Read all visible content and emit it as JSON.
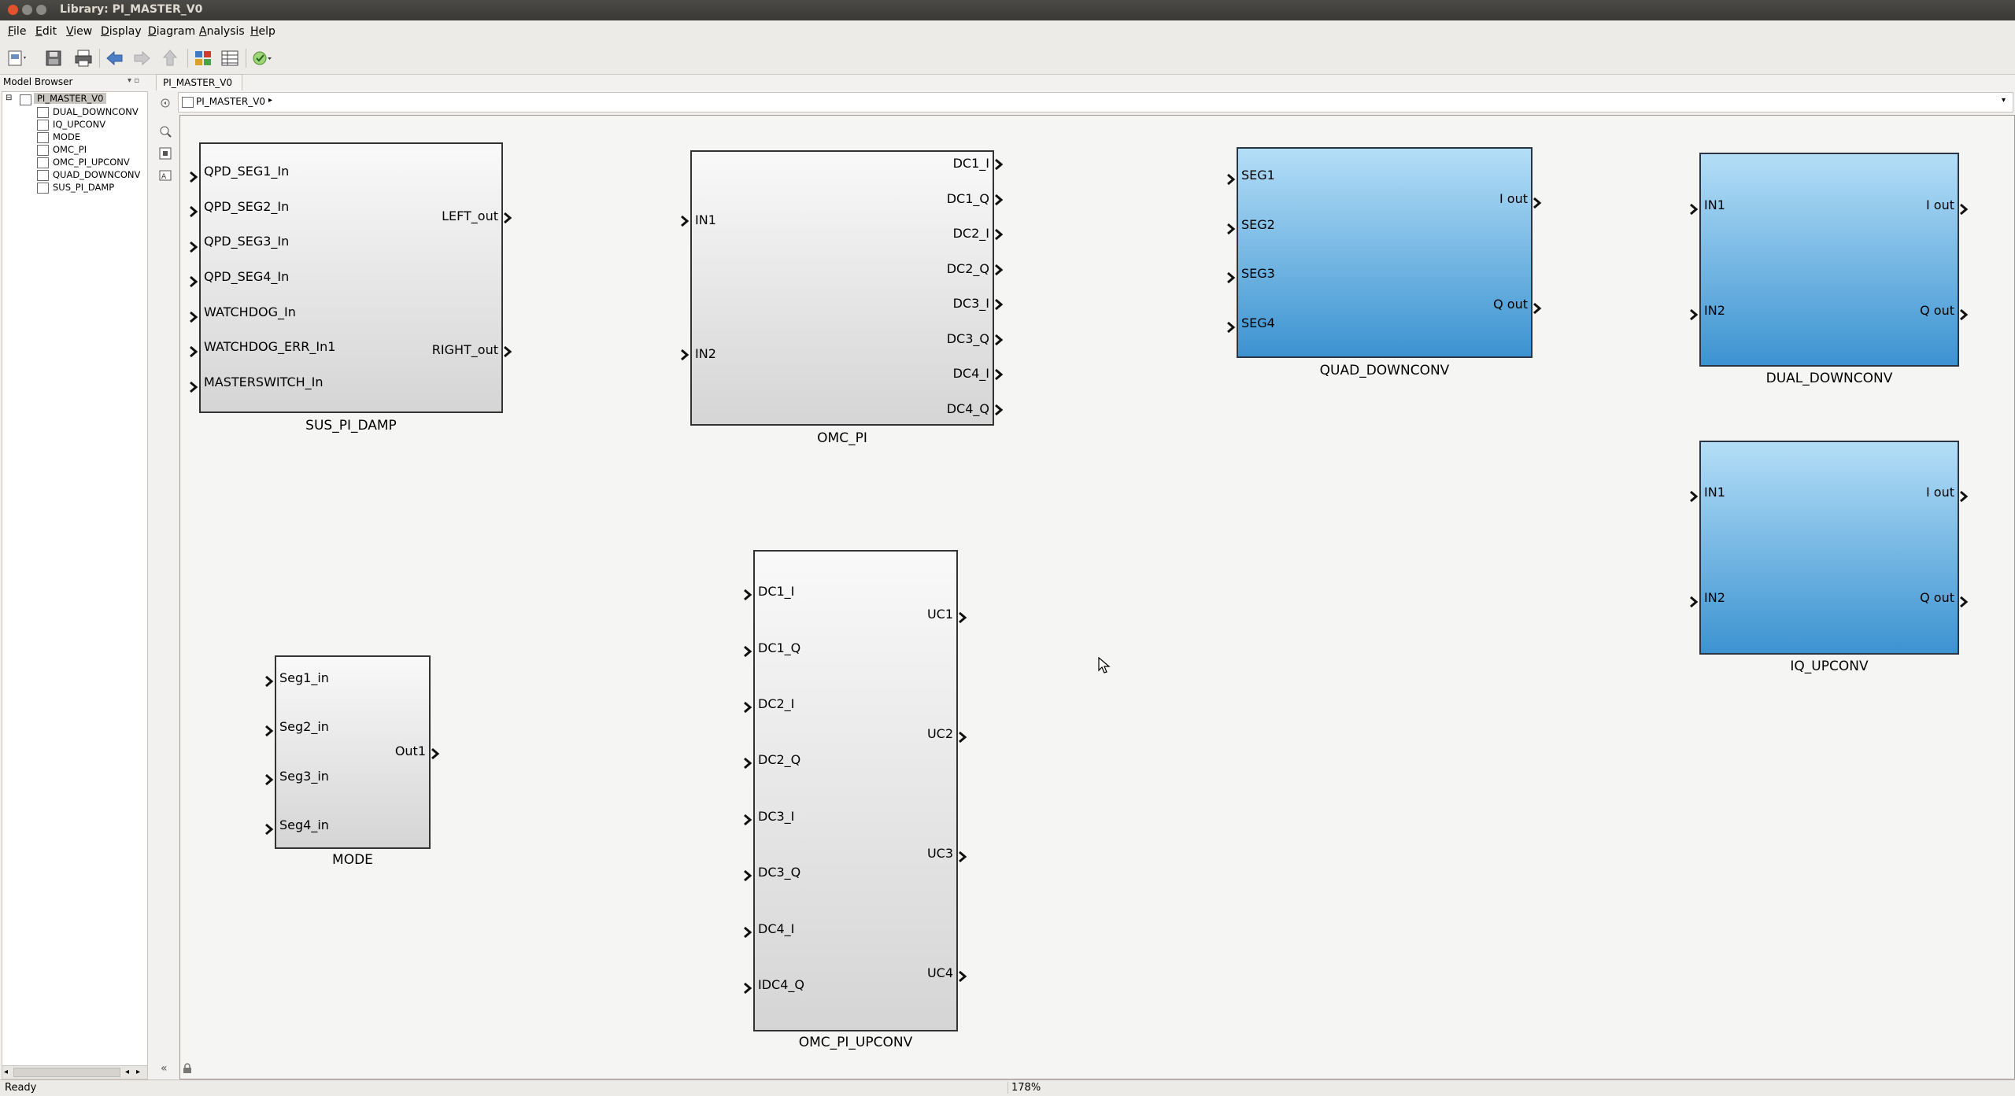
{
  "window": {
    "title": "Library: PI_MASTER_V0"
  },
  "menu": [
    "File",
    "Edit",
    "View",
    "Display",
    "Diagram",
    "Analysis",
    "Help"
  ],
  "browser": {
    "title": "Model Browser",
    "root": "PI_MASTER_V0",
    "items": [
      "DUAL_DOWNCONV",
      "IQ_UPCONV",
      "MODE",
      "OMC_PI",
      "OMC_PI_UPCONV",
      "QUAD_DOWNCONV",
      "SUS_PI_DAMP"
    ]
  },
  "tab": {
    "label": "PI_MASTER_V0"
  },
  "breadcrumb": {
    "label": "PI_MASTER_V0"
  },
  "blocks": {
    "sus": {
      "name": "SUS_PI_DAMP",
      "inputs": [
        "QPD_SEG1_In",
        "QPD_SEG2_In",
        "QPD_SEG3_In",
        "QPD_SEG4_In",
        "WATCHDOG_In",
        "WATCHDOG_ERR_In1",
        "MASTERSWITCH_In"
      ],
      "outputs": [
        "LEFT_out",
        "RIGHT_out"
      ]
    },
    "omcpi": {
      "name": "OMC_PI",
      "inputs": [
        "IN1",
        "IN2"
      ],
      "outputs": [
        "DC1_I",
        "DC1_Q",
        "DC2_I",
        "DC2_Q",
        "DC3_I",
        "DC3_Q",
        "DC4_I",
        "DC4_Q"
      ]
    },
    "quad": {
      "name": "QUAD_DOWNCONV",
      "inputs": [
        "SEG1",
        "SEG2",
        "SEG3",
        "SEG4"
      ],
      "outputs": [
        "I out",
        "Q out"
      ]
    },
    "dual": {
      "name": "DUAL_DOWNCONV",
      "inputs": [
        "IN1",
        "IN2"
      ],
      "outputs": [
        "I out",
        "Q out"
      ]
    },
    "iqup": {
      "name": "IQ_UPCONV",
      "inputs": [
        "IN1",
        "IN2"
      ],
      "outputs": [
        "I out",
        "Q out"
      ]
    },
    "mode": {
      "name": "MODE",
      "inputs": [
        "Seg1_in",
        "Seg2_in",
        "Seg3_in",
        "Seg4_in"
      ],
      "outputs": [
        "Out1"
      ]
    },
    "omcup": {
      "name": "OMC_PI_UPCONV",
      "inputs": [
        "DC1_I",
        "DC1_Q",
        "DC2_I",
        "DC2_Q",
        "DC3_I",
        "DC3_Q",
        "DC4_I",
        "IDC4_Q"
      ],
      "outputs": [
        "UC1",
        "UC2",
        "UC3",
        "UC4"
      ]
    }
  },
  "status": {
    "text": "Ready",
    "zoom": "178%"
  }
}
